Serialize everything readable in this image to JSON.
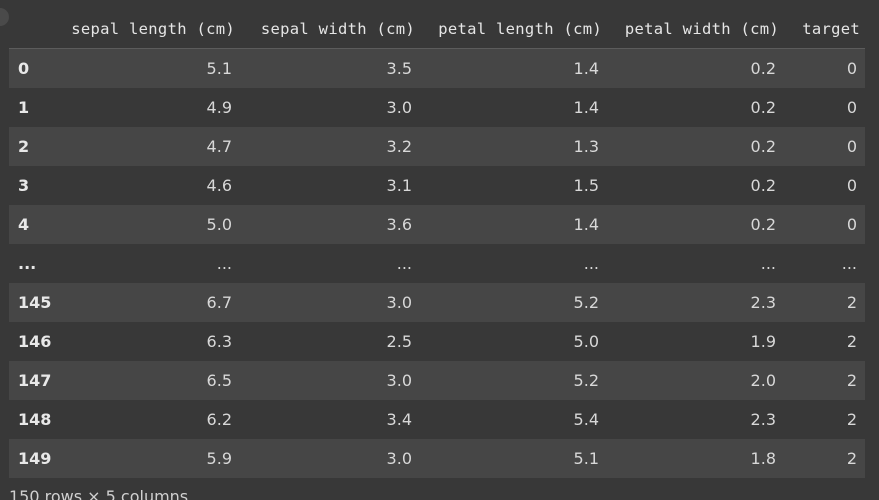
{
  "table": {
    "columns": [
      "",
      "sepal length (cm)",
      "sepal width (cm)",
      "petal length (cm)",
      "petal width (cm)",
      "target"
    ],
    "rows": [
      [
        "0",
        "5.1",
        "3.5",
        "1.4",
        "0.2",
        "0"
      ],
      [
        "1",
        "4.9",
        "3.0",
        "1.4",
        "0.2",
        "0"
      ],
      [
        "2",
        "4.7",
        "3.2",
        "1.3",
        "0.2",
        "0"
      ],
      [
        "3",
        "4.6",
        "3.1",
        "1.5",
        "0.2",
        "0"
      ],
      [
        "4",
        "5.0",
        "3.6",
        "1.4",
        "0.2",
        "0"
      ],
      [
        "...",
        "...",
        "...",
        "...",
        "...",
        "..."
      ],
      [
        "145",
        "6.7",
        "3.0",
        "5.2",
        "2.3",
        "2"
      ],
      [
        "146",
        "6.3",
        "2.5",
        "5.0",
        "1.9",
        "2"
      ],
      [
        "147",
        "6.5",
        "3.0",
        "5.2",
        "2.0",
        "2"
      ],
      [
        "148",
        "6.2",
        "3.4",
        "5.4",
        "2.3",
        "2"
      ],
      [
        "149",
        "5.9",
        "3.0",
        "5.1",
        "1.8",
        "2"
      ]
    ]
  },
  "footer": {
    "shape_text": "150 rows × 5 columns"
  },
  "colors": {
    "background": "#383838",
    "row_stripe": "#464646",
    "text": "#d8d8d8"
  }
}
